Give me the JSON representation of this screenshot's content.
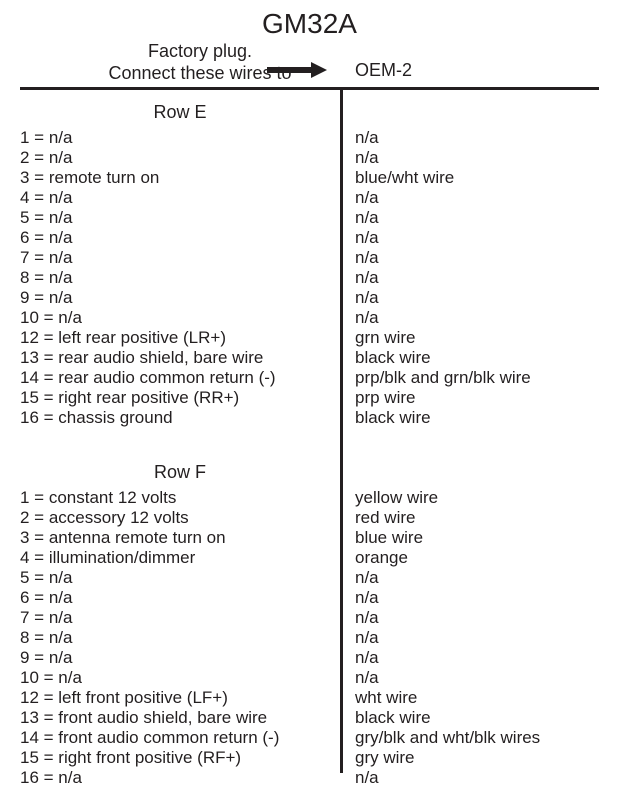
{
  "title": "GM32A",
  "header": {
    "factory_line1": "Factory plug.",
    "factory_line2": "Connect these wires to",
    "oem": "OEM-2"
  },
  "sections": [
    {
      "heading": "Row E",
      "rows": [
        {
          "pin": "1",
          "eq": "=",
          "desc": "n/a",
          "oem": "n/a"
        },
        {
          "pin": "2",
          "eq": "=",
          "desc": "n/a",
          "oem": "n/a"
        },
        {
          "pin": "3",
          "eq": "=",
          "desc": "remote turn on",
          "oem": "blue/wht wire"
        },
        {
          "pin": "4",
          "eq": "=",
          "desc": "n/a",
          "oem": "n/a"
        },
        {
          "pin": "5",
          "eq": "=",
          "desc": "n/a",
          "oem": "n/a"
        },
        {
          "pin": "6",
          "eq": "=",
          "desc": "n/a",
          "oem": "n/a"
        },
        {
          "pin": "7",
          "eq": "=",
          "desc": "n/a",
          "oem": "n/a"
        },
        {
          "pin": "8",
          "eq": "=",
          "desc": "n/a",
          "oem": "n/a"
        },
        {
          "pin": "9",
          "eq": "=",
          "desc": "n/a",
          "oem": "n/a"
        },
        {
          "pin": "10",
          "eq": "=",
          "desc": "n/a",
          "oem": "n/a"
        },
        {
          "pin": "12",
          "eq": "=",
          "desc": "left rear positive (LR+)",
          "oem": "grn wire"
        },
        {
          "pin": "13",
          "eq": "=",
          "desc": "rear audio shield, bare wire",
          "oem": "black wire"
        },
        {
          "pin": "14",
          "eq": "=",
          "desc": "rear audio common return (-)",
          "oem": "prp/blk and grn/blk wire"
        },
        {
          "pin": "15",
          "eq": "=",
          "desc": "right rear positive (RR+)",
          "oem": "prp wire"
        },
        {
          "pin": "16",
          "eq": "=",
          "desc": "chassis ground",
          "oem": "black wire"
        }
      ]
    },
    {
      "heading": "Row F",
      "rows": [
        {
          "pin": "1",
          "eq": "=",
          "desc": "constant 12 volts",
          "oem": "yellow wire"
        },
        {
          "pin": "2",
          "eq": "=",
          "desc": "accessory 12 volts",
          "oem": "red wire"
        },
        {
          "pin": "3",
          "eq": "=",
          "desc": "antenna remote turn on",
          "oem": "blue wire"
        },
        {
          "pin": "4",
          "eq": "=",
          "desc": "illumination/dimmer",
          "oem": "orange"
        },
        {
          "pin": "5",
          "eq": "=",
          "desc": "n/a",
          "oem": "n/a"
        },
        {
          "pin": "6",
          "eq": "=",
          "desc": "n/a",
          "oem": "n/a"
        },
        {
          "pin": "7",
          "eq": "=",
          "desc": "n/a",
          "oem": "n/a"
        },
        {
          "pin": "8",
          "eq": "=",
          "desc": "n/a",
          "oem": "n/a"
        },
        {
          "pin": "9",
          "eq": "=",
          "desc": "n/a",
          "oem": "n/a"
        },
        {
          "pin": "10",
          "eq": "=",
          "desc": "n/a",
          "oem": "n/a"
        },
        {
          "pin": "12",
          "eq": "=",
          "desc": "left front positive (LF+)",
          "oem": "wht wire"
        },
        {
          "pin": "13",
          "eq": "=",
          "desc": "front audio shield, bare wire",
          "oem": "black wire"
        },
        {
          "pin": "14",
          "eq": "=",
          "desc": "front audio common return (-)",
          "oem": "gry/blk and wht/blk wires"
        },
        {
          "pin": "15",
          "eq": "=",
          "desc": "right front positive (RF+)",
          "oem": "gry wire"
        },
        {
          "pin": "16",
          "eq": "=",
          "desc": "n/a",
          "oem": "n/a"
        }
      ]
    }
  ]
}
